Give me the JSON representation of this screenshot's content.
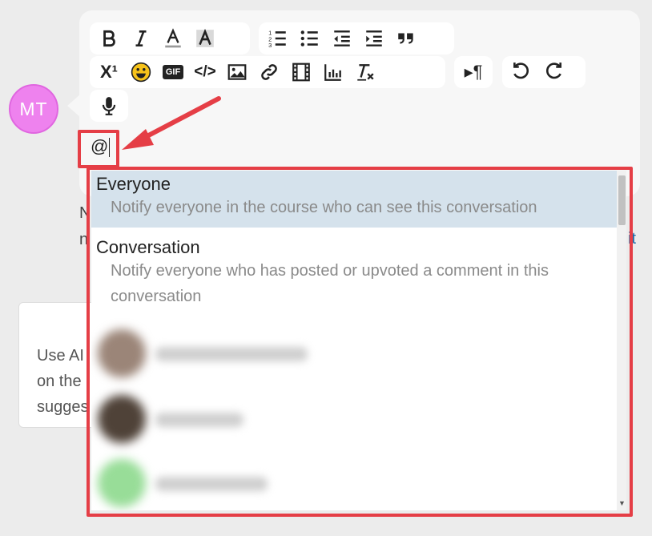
{
  "avatar": {
    "initials": "MT",
    "color": "#ee82ee"
  },
  "toolbar": {
    "row1": [
      "bold-icon",
      "italic-icon",
      "font-color-icon",
      "highlight-icon",
      "ordered-list-icon",
      "bullet-list-icon",
      "outdent-icon",
      "indent-icon",
      "quote-icon"
    ],
    "row2": [
      "superscript-icon",
      "emoji-icon",
      "gif-icon",
      "code-icon",
      "image-icon",
      "link-icon",
      "video-icon",
      "chart-icon",
      "clear-format-icon",
      "paragraph-direction-icon",
      "undo-icon",
      "redo-icon"
    ],
    "row3": [
      "microphone-icon"
    ],
    "superscript_label": "X¹",
    "gif_label": "GIF",
    "code_label": "</>",
    "paragraph_label": "▸¶"
  },
  "editor": {
    "input_value": "@"
  },
  "background": {
    "partial_letter_1": "N",
    "partial_letter_2": "n",
    "partial_right": "it",
    "ai_card_lines": [
      "Use AI",
      "on the",
      "sugges"
    ]
  },
  "mention_dropdown": {
    "items": [
      {
        "title": "Everyone",
        "description": "Notify everyone in the course who can see this conversation"
      },
      {
        "title": "Conversation",
        "description": "Notify everyone who has posted or upvoted a comment in this conversation"
      }
    ]
  },
  "colors": {
    "highlight": "#e53e46",
    "selected_row": "#d5e2ec",
    "accent": "#ee82ee"
  }
}
